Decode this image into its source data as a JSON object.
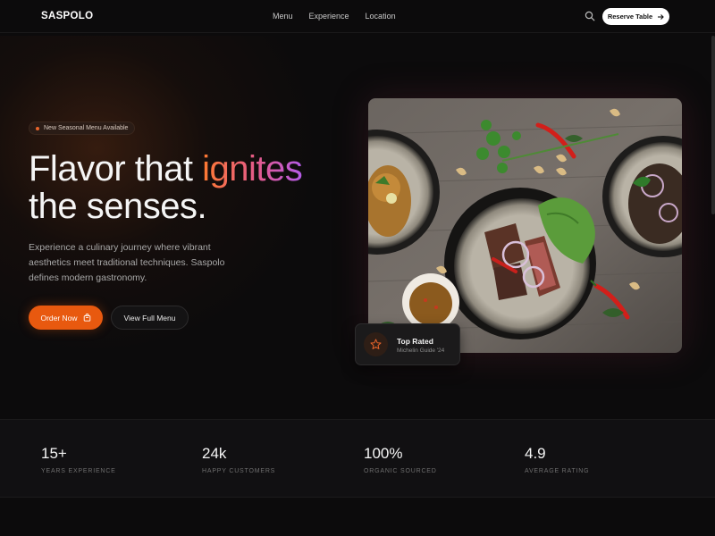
{
  "nav": {
    "brand": "SASPOLO",
    "links": [
      "Menu",
      "Experience",
      "Location"
    ],
    "search_icon": "search-icon",
    "reserve_label": "Reserve Table",
    "reserve_icon": "arrow-right-icon"
  },
  "hero": {
    "badge": "New Seasonal Menu Available",
    "headline_prefix": "Flavor that ",
    "headline_accent": "ignites",
    "headline_suffix": "the senses.",
    "lead": "Experience a culinary journey where vibrant aesthetics meet traditional techniques. Saspolo defines modern gastronomy.",
    "primary_cta": "Order Now",
    "primary_cta_icon": "shopping-bag-icon",
    "secondary_cta": "View Full Menu",
    "image_alt": "Plates of grilled steak salad, fried chicken and beef with herbs, chili and cashews on a wooden table",
    "rating_card": {
      "icon": "star-icon",
      "title": "Top Rated",
      "subtitle": "Michelin Guide '24"
    }
  },
  "stats": [
    {
      "value": "15+",
      "label": "Years Experience"
    },
    {
      "value": "24k",
      "label": "Happy Customers"
    },
    {
      "value": "100%",
      "label": "Organic Sourced"
    },
    {
      "value": "4.9",
      "label": "Average Rating"
    }
  ],
  "colors": {
    "accent": "#e8590f",
    "background": "#0c0b0c",
    "gradient": [
      "#ff7a2f",
      "#e45a8c",
      "#b45be8"
    ]
  }
}
